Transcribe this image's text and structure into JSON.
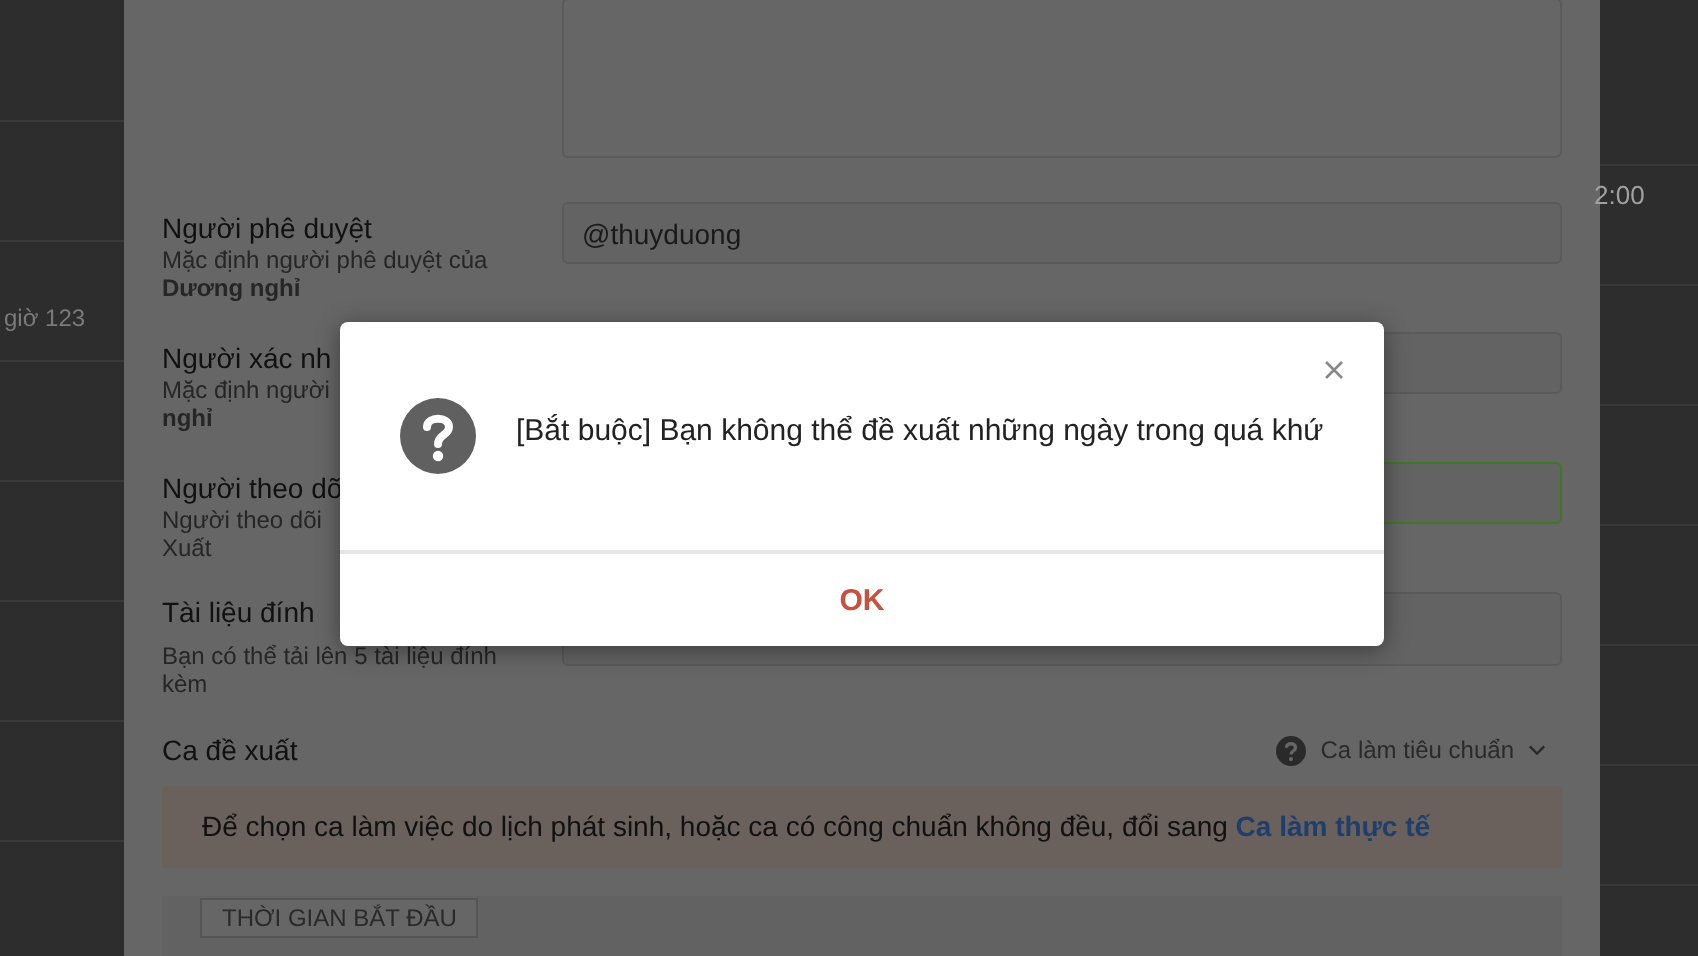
{
  "background_page": {
    "left_text": "giờ 123",
    "right_text": "2:00"
  },
  "form": {
    "rows": [
      {
        "label": "Người phê duyệt",
        "hint_lines": [
          {
            "text": "Mặc định người phê duyệt của",
            "bold": false
          },
          {
            "text": "Dương nghỉ",
            "bold": true
          }
        ],
        "field_value": "@thuyduong",
        "focused": false
      },
      {
        "label": "Người xác nh",
        "hint_lines": [
          {
            "text": "Mặc định người",
            "bold": false
          },
          {
            "text": "nghỉ",
            "bold": true
          }
        ],
        "field_value": "",
        "focused": false
      },
      {
        "label": "Người theo dõ",
        "hint_lines": [
          {
            "text": "Người theo dõi",
            "bold": false
          },
          {
            "text": "Xuất",
            "bold": false
          }
        ],
        "field_value": "",
        "focused": true
      },
      {
        "label": "Tài liệu đính",
        "hint_lines": [
          {
            "text": "Bạn có thể tải lên 5 tài liệu đính",
            "bold": false
          },
          {
            "text": "kèm",
            "bold": false
          }
        ],
        "field_value": "",
        "focused": false
      }
    ],
    "shift": {
      "label": "Ca đề xuất",
      "selector": "Ca làm tiêu chuẩn"
    },
    "notice": {
      "text": "Để chọn ca làm việc do lịch phát sinh, hoặc ca có công chuẩn không đều, đổi sang",
      "link": "Ca làm thực tế"
    },
    "tab": "THỜI GIAN BẮT ĐẦU"
  },
  "dialog": {
    "message": "[Bắt buộc] Bạn không thể đề xuất những ngày trong quá khứ",
    "button": "OK"
  }
}
